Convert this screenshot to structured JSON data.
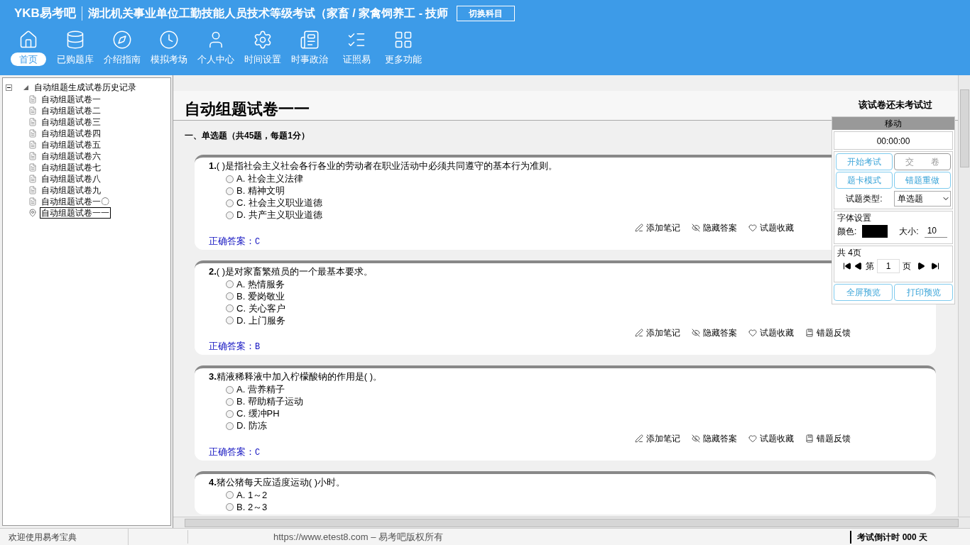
{
  "header": {
    "logo": "YKB易考吧",
    "title": "湖北机关事业单位工勤技能人员技术等级考试（家畜 / 家禽饲养工 - 技师",
    "switch_button": "切换科目"
  },
  "nav": [
    {
      "label": "首页",
      "selected": true
    },
    {
      "label": "已购题库",
      "selected": false
    },
    {
      "label": "介绍指南",
      "selected": false
    },
    {
      "label": "模拟考场",
      "selected": false
    },
    {
      "label": "个人中心",
      "selected": false
    },
    {
      "label": "时间设置",
      "selected": false
    },
    {
      "label": "时事政治",
      "selected": false
    },
    {
      "label": "证照易",
      "selected": false
    },
    {
      "label": "更多功能",
      "selected": false
    }
  ],
  "tree": {
    "root": "自动组题生成试卷历史记录",
    "expanded": true,
    "children": [
      {
        "label": "自动组题试卷一",
        "selected": false
      },
      {
        "label": "自动组题试卷二",
        "selected": false
      },
      {
        "label": "自动组题试卷三",
        "selected": false
      },
      {
        "label": "自动组题试卷四",
        "selected": false
      },
      {
        "label": "自动组题试卷五",
        "selected": false
      },
      {
        "label": "自动组题试卷六",
        "selected": false
      },
      {
        "label": "自动组题试卷七",
        "selected": false
      },
      {
        "label": "自动组题试卷八",
        "selected": false
      },
      {
        "label": "自动组题试卷九",
        "selected": false
      },
      {
        "label": "自动组题试卷一〇",
        "selected": false
      },
      {
        "label": "自动组题试卷一一",
        "selected": true
      }
    ]
  },
  "paper": {
    "title": "自动组题试卷一一",
    "status": "该试卷还未考试过",
    "section": "一、单选题（共45题，每题1分）",
    "questions": [
      {
        "number": "1.",
        "text": "( )是指社会主义社会各行各业的劳动者在职业活动中必须共同遵守的基本行为准则。",
        "options": [
          {
            "label": "A. 社会主义法律",
            "selected": false
          },
          {
            "label": "B. 精神文明",
            "selected": false
          },
          {
            "label": "C. 社会主义职业道德",
            "selected": false
          },
          {
            "label": "D. 共产主义职业道德",
            "selected": false
          }
        ],
        "actions": [
          "添加笔记",
          "隐藏答案",
          "试题收藏"
        ],
        "answer_label": "正确答案：",
        "answer": "C"
      },
      {
        "number": "2.",
        "text": "( )是对家畜繁殖员的一个最基本要求。",
        "options": [
          {
            "label": "A. 热情服务",
            "selected": false
          },
          {
            "label": "B. 爱岗敬业",
            "selected": false
          },
          {
            "label": "C. 关心客户",
            "selected": false
          },
          {
            "label": "D. 上门服务",
            "selected": false
          }
        ],
        "actions": [
          "添加笔记",
          "隐藏答案",
          "试题收藏",
          "错题反馈"
        ],
        "answer_label": "正确答案：",
        "answer": "B"
      },
      {
        "number": "3.",
        "text": "精液稀释液中加入柠檬酸钠的作用是( )。",
        "options": [
          {
            "label": "A. 营养精子",
            "selected": false
          },
          {
            "label": "B. 帮助精子运动",
            "selected": false
          },
          {
            "label": "C. 缓冲PH",
            "selected": false
          },
          {
            "label": "D. 防冻",
            "selected": false
          }
        ],
        "actions": [
          "添加笔记",
          "隐藏答案",
          "试题收藏",
          "错题反馈"
        ],
        "answer_label": "正确答案：",
        "answer": "C"
      },
      {
        "number": "4.",
        "text": "猪公猪每天应适度运动( )小时。",
        "options": [
          {
            "label": "A. 1～2",
            "selected": false
          },
          {
            "label": "B. 2～3",
            "selected": false
          }
        ]
      }
    ]
  },
  "panel": {
    "move": "移动",
    "timer": "00:00:00",
    "buttons": [
      {
        "label": "开始考试",
        "disabled": false
      },
      {
        "label": "交　　卷",
        "disabled": true
      },
      {
        "label": "题卡模式",
        "disabled": false
      },
      {
        "label": "错题重做",
        "disabled": false
      }
    ],
    "type_label": "试题类型:",
    "type_value": "单选题",
    "font_legend": "字体设置",
    "color_label": "颜色:",
    "size_label": "大小:",
    "size_value": "10",
    "pages_legend": "共 4页",
    "page_prefix": "第",
    "page_value": "1",
    "page_suffix": "页",
    "bottom_buttons": [
      "全屏预览",
      "打印预览"
    ]
  },
  "status_bar": {
    "welcome": "欢迎使用易考宝典",
    "copyright": "https://www.etest8.com – 易考吧版权所有",
    "countdown": "考试倒计时 000 天"
  }
}
